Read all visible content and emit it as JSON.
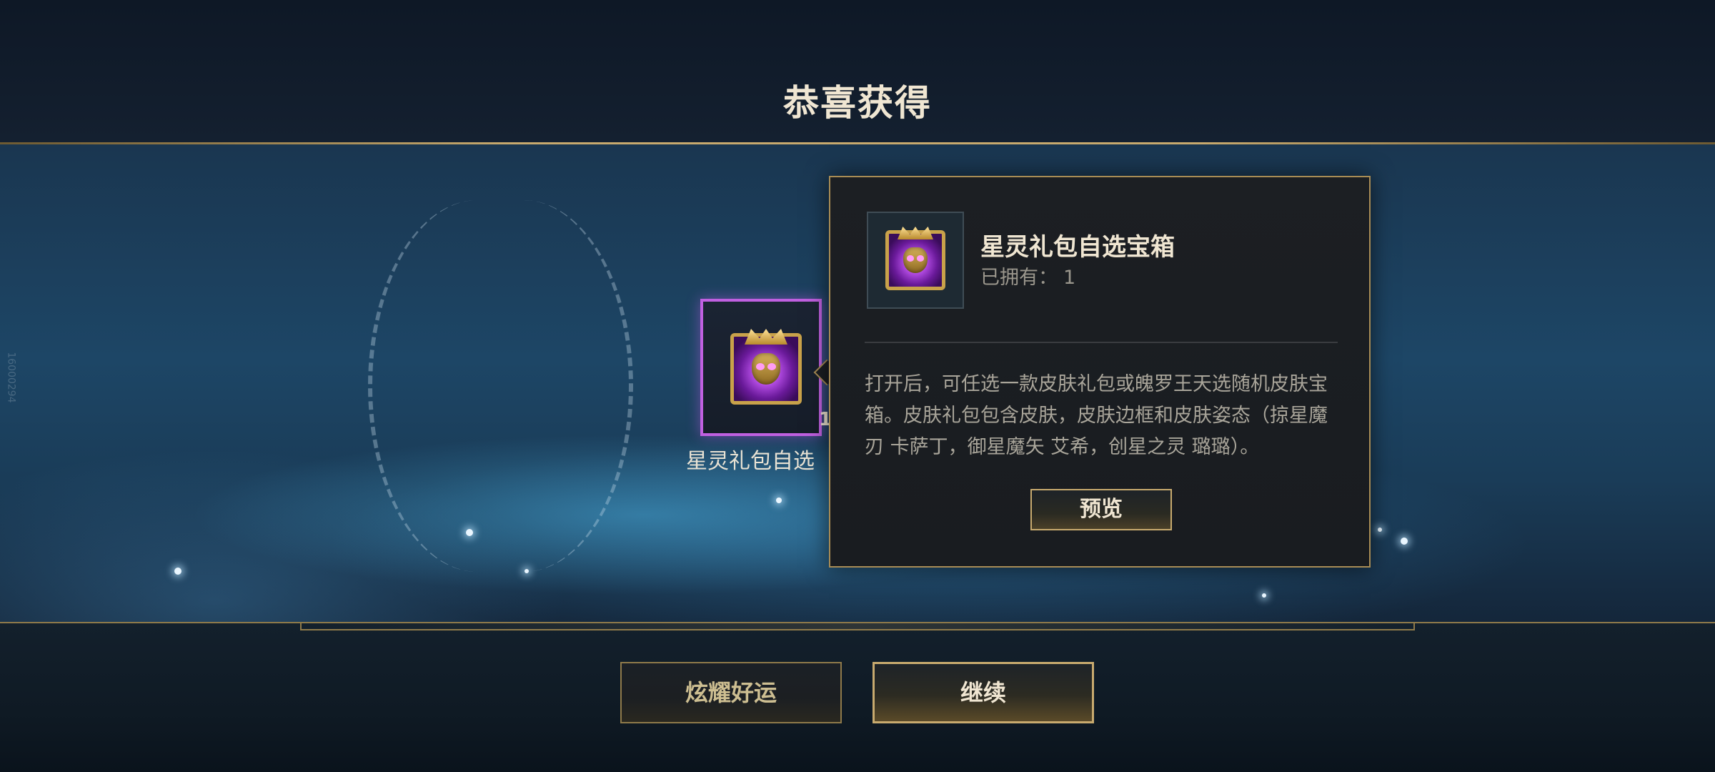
{
  "header": {
    "title": "恭喜获得"
  },
  "side_id": "16000294",
  "reward": {
    "item_name": "星灵礼包自选",
    "count": "1",
    "icon": "star-guardian-chest-icon"
  },
  "tooltip": {
    "name": "星灵礼包自选宝箱",
    "owned_label": "已拥有：",
    "owned_value": "1",
    "description": "打开后，可任选一款皮肤礼包或魄罗王天选随机皮肤宝箱。皮肤礼包包含皮肤，皮肤边框和皮肤姿态（掠星魔刃 卡萨丁，御星魔矢 艾希，创星之灵 璐璐）。",
    "preview_label": "预览"
  },
  "footer": {
    "share_label": "炫耀好运",
    "continue_label": "继续"
  },
  "colors": {
    "gold": "#c8aa6e",
    "rarity_purple": "#c060e0",
    "panel_bg": "#1c1f23"
  }
}
